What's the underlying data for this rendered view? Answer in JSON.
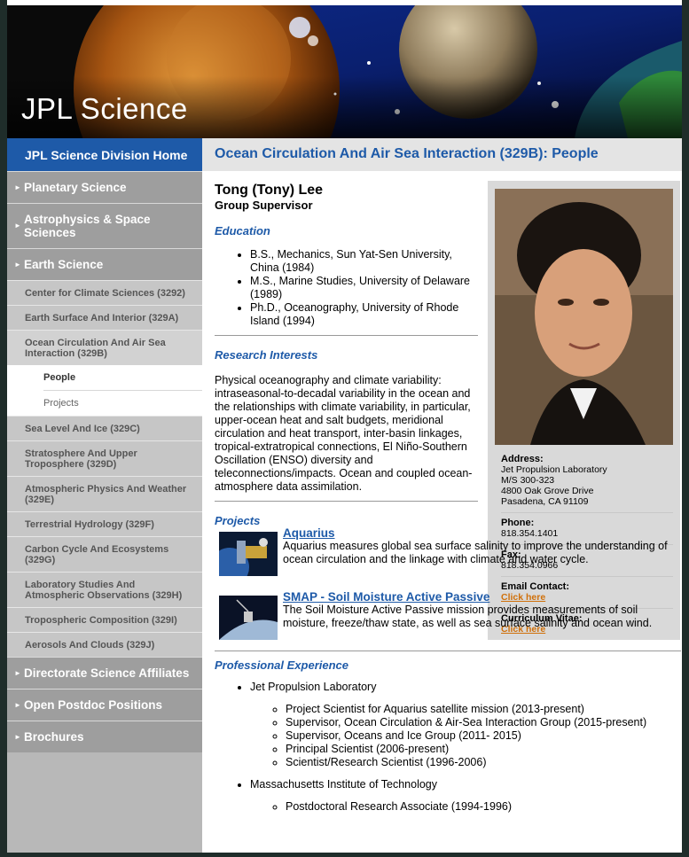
{
  "banner": {
    "title": "JPL Science"
  },
  "sidebar": {
    "home": "JPL Science Division Home",
    "top1": "Planetary Science",
    "top2": "Astrophysics & Space Sciences",
    "top3": "Earth Science",
    "sub": [
      "Center for Climate Sciences (3292)",
      "Earth Surface And Interior (329A)",
      "Ocean Circulation And Air Sea Interaction (329B)",
      "Sea Level And Ice (329C)",
      "Stratosphere And Upper Troposphere (329D)",
      "Atmospheric Physics And Weather (329E)",
      "Terrestrial Hydrology (329F)",
      "Carbon Cycle And Ecosystems (329G)",
      "Laboratory Studies And Atmospheric Observations (329H)",
      "Tropospheric Composition (329I)",
      "Aerosols And Clouds (329J)"
    ],
    "subsub": [
      "People",
      "Projects"
    ],
    "top4": "Directorate Science Affiliates",
    "top5": "Open Postdoc Positions",
    "top6": "Brochures"
  },
  "page": {
    "title": "Ocean Circulation And Air Sea Interaction (329B): People",
    "name": "Tong (Tony) Lee",
    "role": "Group Supervisor",
    "education_heading": "Education",
    "education": [
      "B.S., Mechanics, Sun Yat-Sen University, China (1984)",
      "M.S., Marine Studies, University of Delaware (1989)",
      "Ph.D., Oceanography, University of Rhode Island (1994)"
    ],
    "research_heading": "Research Interests",
    "research_text": "Physical oceanography and climate variability: intraseasonal-to-decadal variability in the ocean and the relationships with climate variability, in particular, upper-ocean heat and salt budgets, meridional circulation and heat transport, inter-basin linkages, tropical-extratropical connections, El Niño-Southern Oscillation (ENSO) diversity and teleconnections/impacts. Ocean and coupled ocean-atmosphere data assimilation.",
    "projects_heading": "Projects",
    "projects": [
      {
        "title": "Aquarius",
        "desc": "Aquarius measures global sea surface salinity to improve the understanding of ocean circulation and the linkage with climate and water cycle."
      },
      {
        "title": "SMAP - Soil Moisture Active Passive",
        "desc": "The Soil Moisture Active Passive mission provides measurements of soil moisture, freeze/thaw state, as well as sea surface salinity and ocean wind."
      }
    ],
    "experience_heading": "Professional Experience",
    "experience": [
      {
        "org": "Jet Propulsion Laboratory",
        "roles": [
          "Project Scientist for Aquarius satellite mission (2013-present)",
          "Supervisor, Ocean Circulation & Air-Sea Interaction Group (2015-present)",
          "Supervisor, Oceans and Ice Group (2011- 2015)",
          "Principal Scientist (2006-present)",
          "Scientist/Research Scientist (1996-2006)"
        ]
      },
      {
        "org": "Massachusetts Institute of Technology",
        "roles": [
          "Postdoctoral Research Associate (1994-1996)"
        ]
      }
    ]
  },
  "contact": {
    "address_label": "Address:",
    "address_lines": [
      "Jet Propulsion Laboratory",
      "M/S 300-323",
      "4800 Oak Grove Drive",
      "Pasadena, CA 91109"
    ],
    "phone_label": "Phone:",
    "phone": "818.354.1401",
    "fax_label": "Fax:",
    "fax": "818.354.0966",
    "email_label": "Email Contact:",
    "email_link": "Click here",
    "cv_label": "Curriculum Vitae:",
    "cv_link": "Click here"
  },
  "colors": {
    "accent": "#1e5aa8",
    "link_orange": "#d0700a",
    "nav_gray": "#9e9e9e"
  }
}
